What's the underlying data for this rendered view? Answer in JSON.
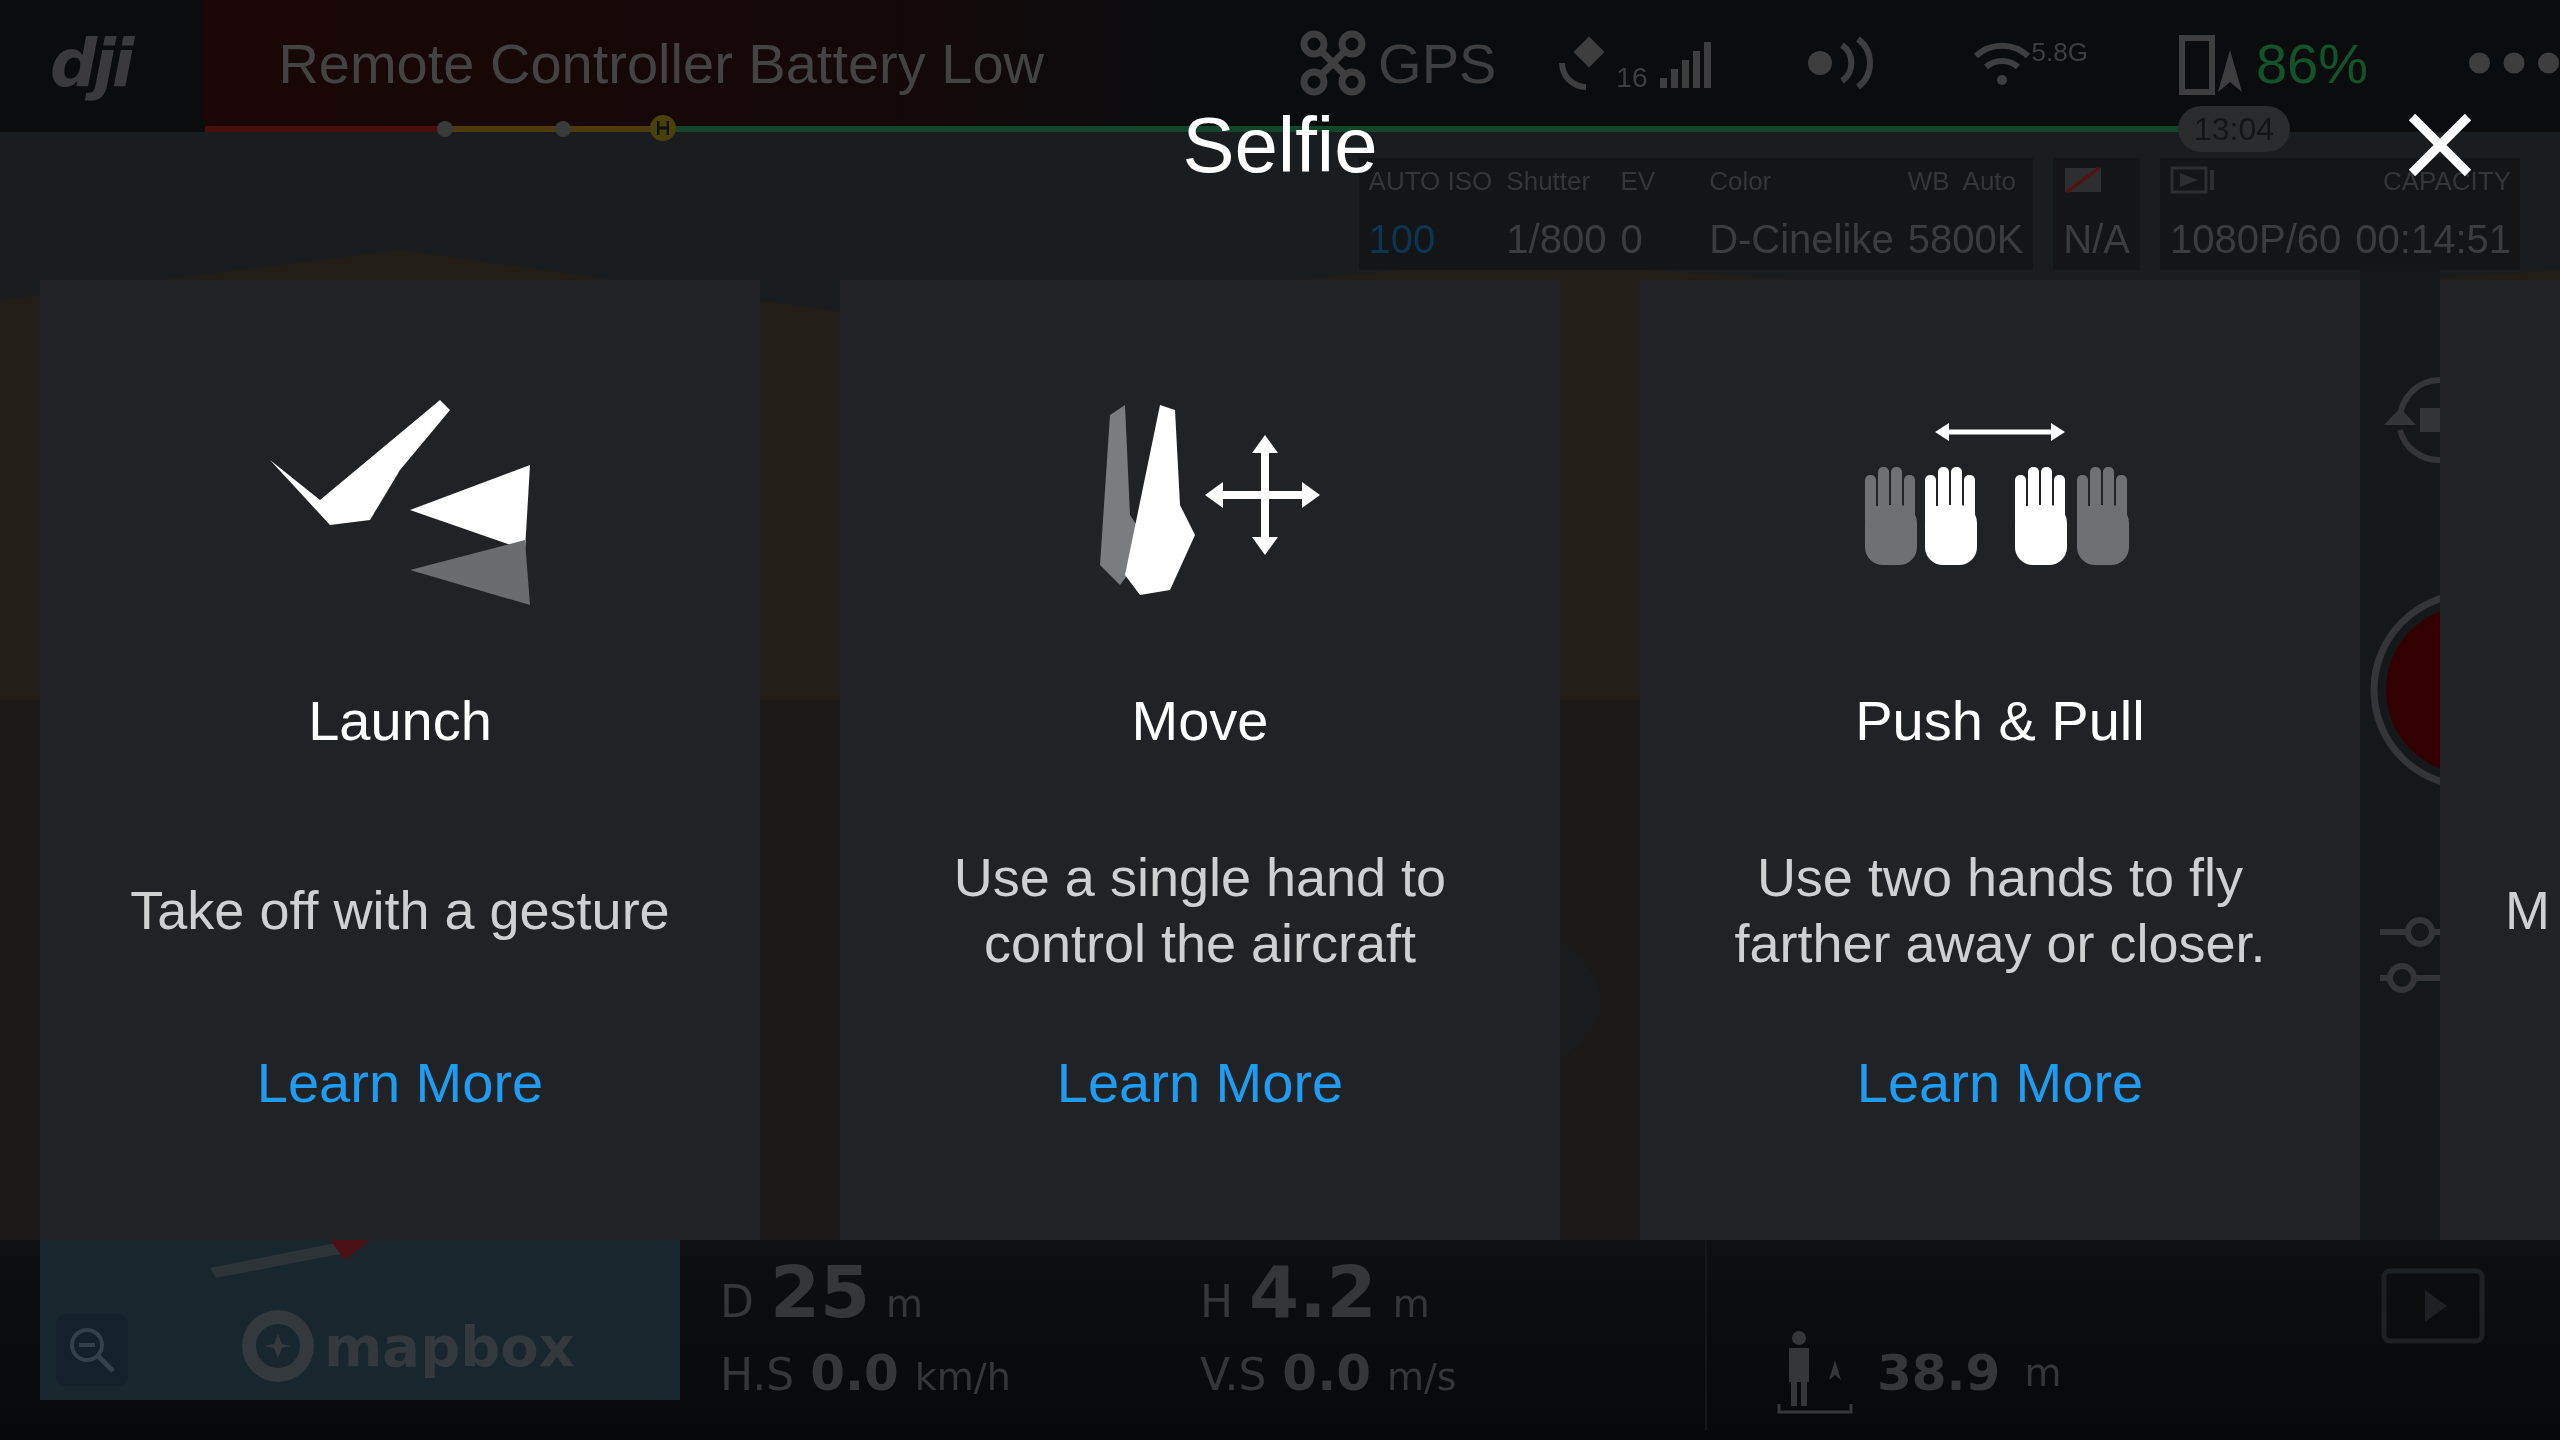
{
  "top_bar": {
    "logo": "dji",
    "alert": "Remote Controller Battery Low",
    "gps_label": "GPS",
    "satellite_count": "16",
    "wifi_band": "5.8G",
    "battery": "86%",
    "flight_time": "13:04"
  },
  "camera_settings": [
    {
      "label": "AUTO ISO",
      "value": "100",
      "accent": true
    },
    {
      "label": "Shutter",
      "value": "1/800",
      "accent": false
    },
    {
      "label": "EV",
      "value": "0",
      "accent": false
    },
    {
      "label": "Color",
      "value": "D-Cinelike",
      "accent": false
    },
    {
      "label": "WB  Auto",
      "value": "5800K",
      "accent": false
    }
  ],
  "sd_card": {
    "value": "N/A"
  },
  "recording": {
    "format": "1080P/60",
    "capacity_label": "CAPACITY",
    "capacity": "00:14:51"
  },
  "dialog": {
    "title": "Selfie",
    "cards": [
      {
        "kind": "launch",
        "title": "Launch",
        "description": "Take off with a gesture",
        "link": "Learn More"
      },
      {
        "kind": "move",
        "title": "Move",
        "description": "Use a single hand to control the aircraft",
        "link": "Learn More"
      },
      {
        "kind": "push_pull",
        "title": "Push & Pull",
        "description": "Use two hands to fly farther away or closer.",
        "link": "Learn More"
      },
      {
        "kind": "partial",
        "description": "M"
      }
    ]
  },
  "map": {
    "attribution": "mapbox"
  },
  "telemetry": [
    {
      "label": "D",
      "value": "25",
      "unit": "m"
    },
    {
      "label": "H",
      "value": "4.2",
      "unit": "m"
    },
    {
      "label": "H.S",
      "value": "0.0",
      "unit": "km/h"
    },
    {
      "label": "V.S",
      "value": "0.0",
      "unit": "m/s"
    }
  ],
  "home_distance": {
    "value": "38.9",
    "unit": "m"
  }
}
